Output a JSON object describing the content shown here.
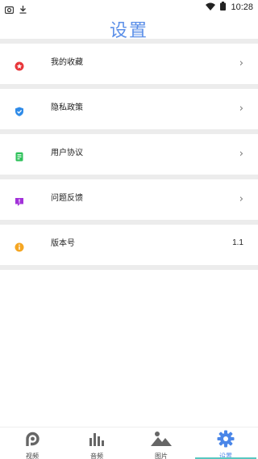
{
  "status_bar": {
    "time": "10:28",
    "left_icons": [
      "screenshot-icon",
      "download-icon"
    ],
    "right_icons": [
      "wifi-icon",
      "battery-icon"
    ]
  },
  "header": {
    "title": "设置"
  },
  "settings": {
    "items": [
      {
        "label": "我的收藏",
        "icon": "favorites-icon",
        "color": "#e8363a",
        "trailing": "chevron"
      },
      {
        "label": "隐私政策",
        "icon": "shield-icon",
        "color": "#2f8be8",
        "trailing": "chevron"
      },
      {
        "label": "用户协议",
        "icon": "agreement-icon",
        "color": "#2fc25b",
        "trailing": "chevron"
      },
      {
        "label": "问题反馈",
        "icon": "feedback-icon",
        "color": "#a231d9",
        "trailing": "chevron"
      },
      {
        "label": "版本号",
        "icon": "info-icon",
        "color": "#f5a623",
        "trailing": "value",
        "value": "1.1"
      }
    ]
  },
  "tab_bar": {
    "tabs": [
      {
        "label": "视频",
        "icon": "video-icon",
        "active": false
      },
      {
        "label": "音频",
        "icon": "audio-icon",
        "active": false
      },
      {
        "label": "图片",
        "icon": "image-icon",
        "active": false
      },
      {
        "label": "设置",
        "icon": "settings-gear-icon",
        "active": true
      }
    ],
    "accent": "#4a86e8",
    "indicator_color": "#58c7c0"
  }
}
